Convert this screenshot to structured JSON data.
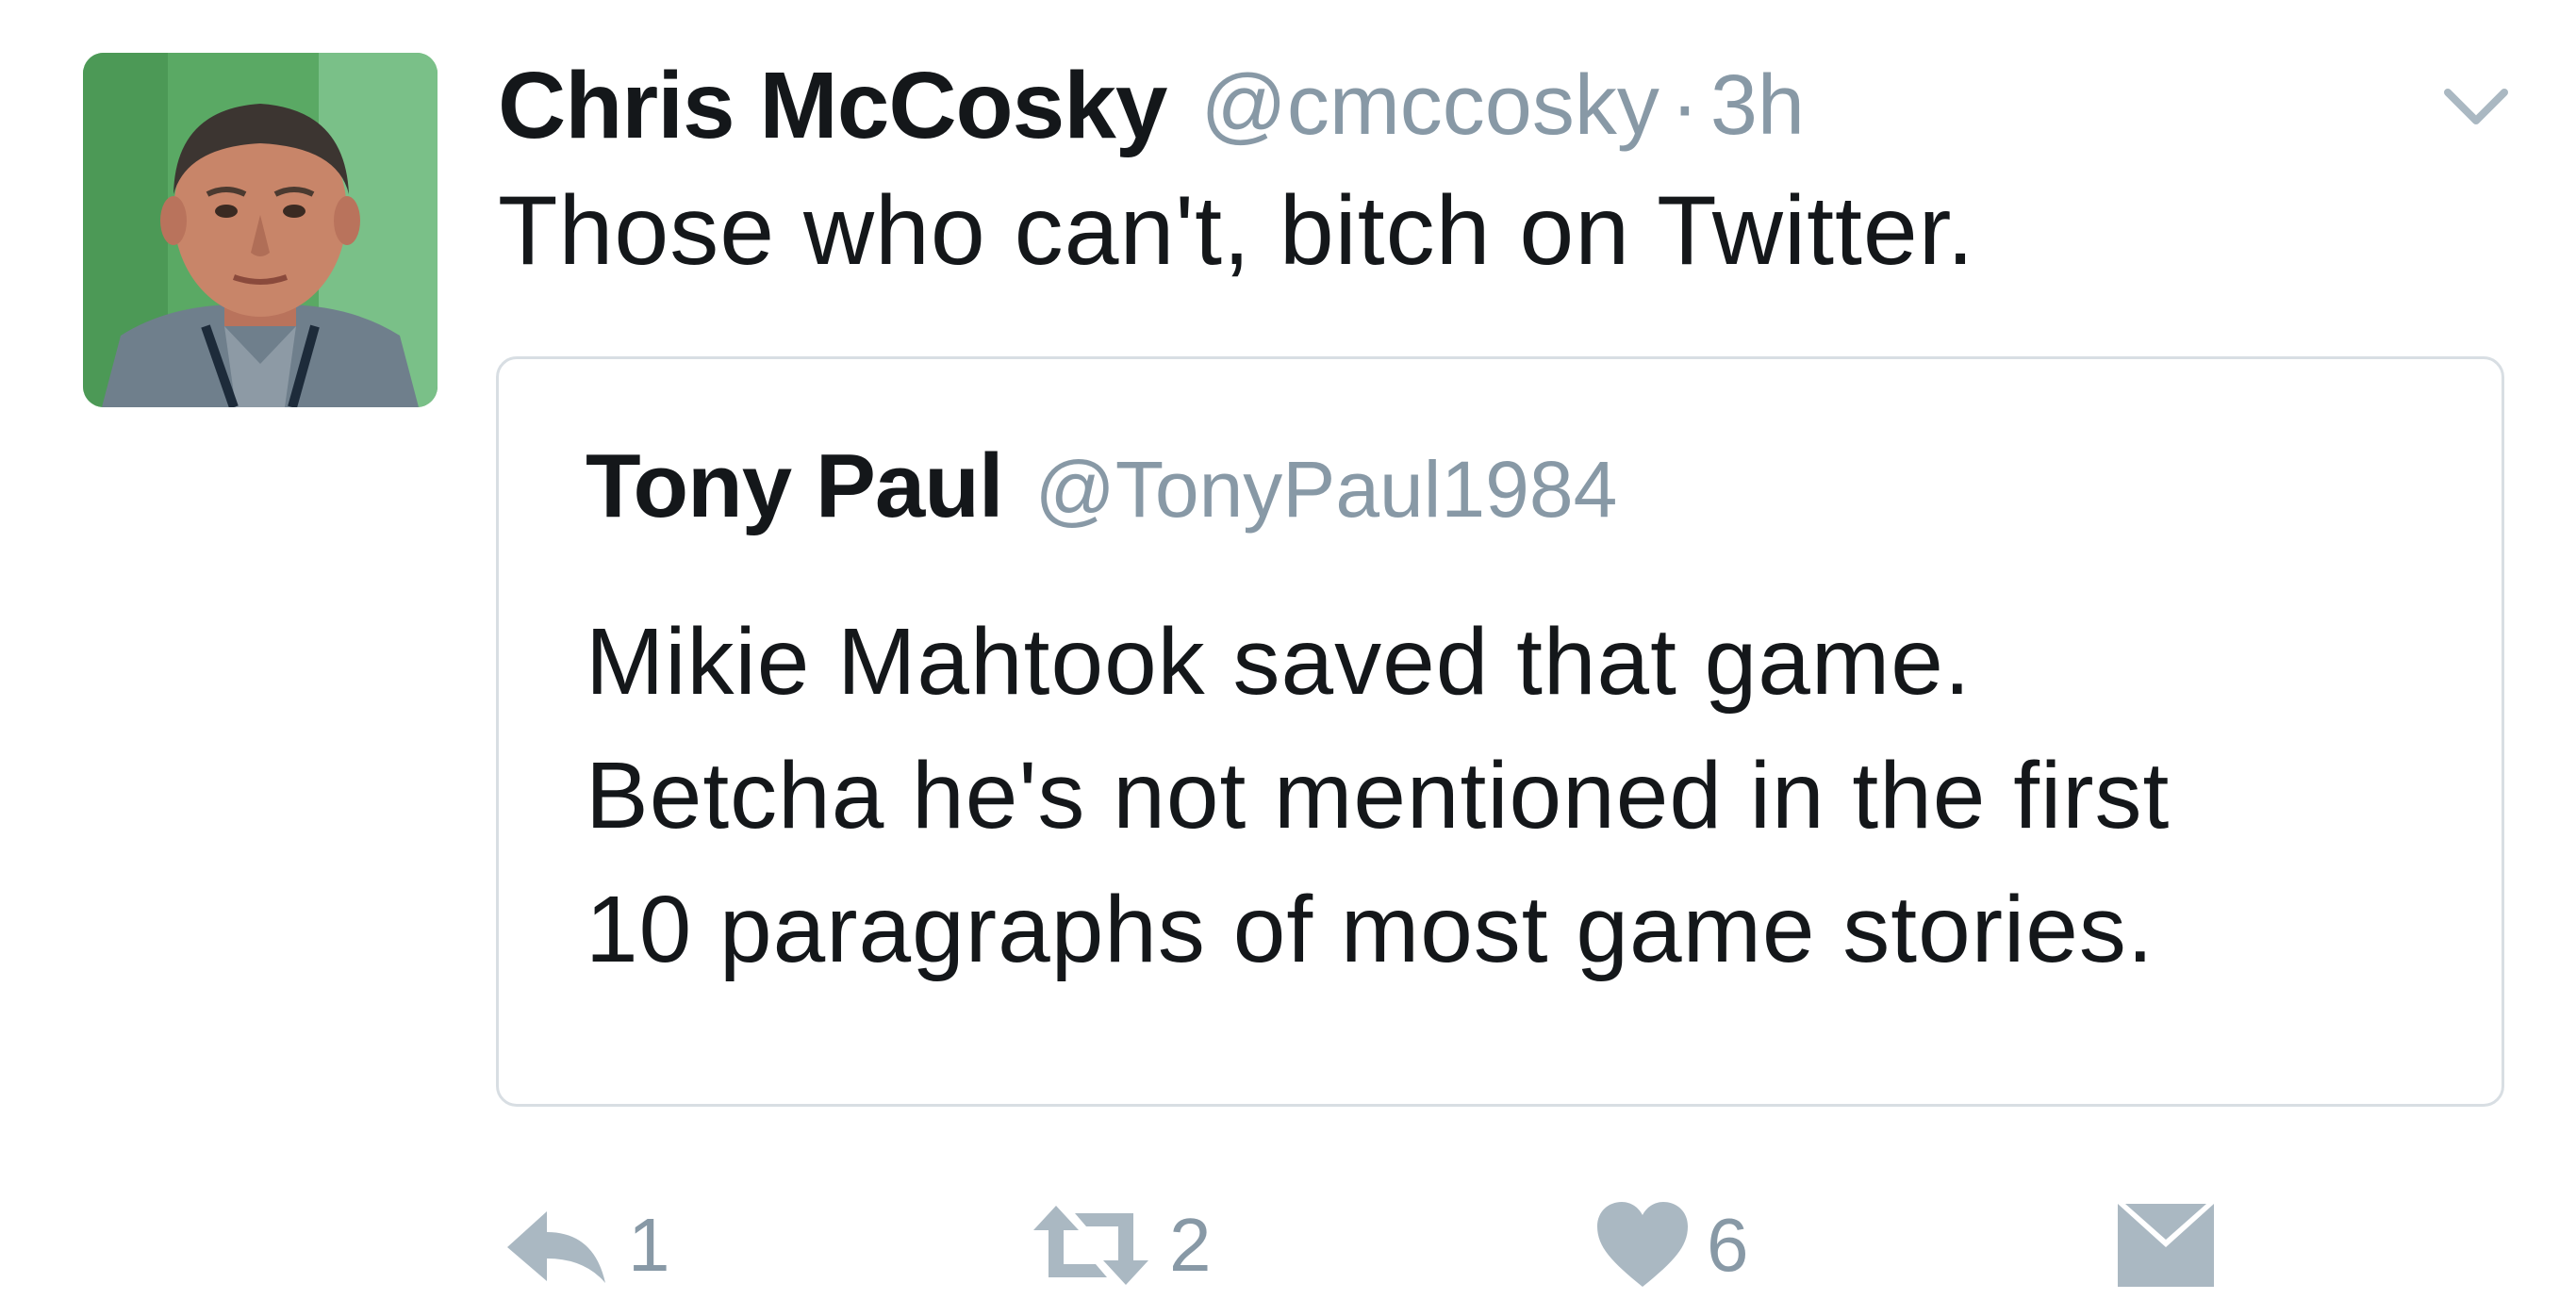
{
  "tweet": {
    "author_name": "Chris McCosky",
    "author_handle": "@cmccosky",
    "separator": "·",
    "time": "3h",
    "text": "Those who can't, bitch on Twitter.",
    "avatar_icon": "person-photo",
    "menu_icon": "chevron-down-icon"
  },
  "quoted_tweet": {
    "author_name": "Tony Paul",
    "author_handle": "@TonyPaul1984",
    "text_lines": [
      "Mikie Mahtook saved that game.",
      "Betcha he's not mentioned in the first",
      "10 paragraphs of most game stories."
    ]
  },
  "actions": {
    "reply": {
      "icon": "reply-icon",
      "count": "1"
    },
    "retweet": {
      "icon": "retweet-icon",
      "count": "2"
    },
    "like": {
      "icon": "heart-icon",
      "count": "6"
    },
    "message": {
      "icon": "envelope-icon"
    }
  },
  "colors": {
    "text": "#14171a",
    "secondary": "#8899a6",
    "border": "#d8dee3"
  }
}
